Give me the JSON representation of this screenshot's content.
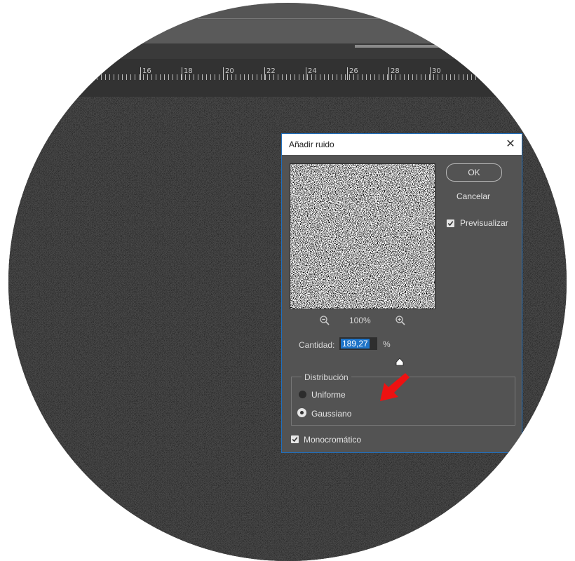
{
  "ruler": {
    "labels": [
      "16",
      "18",
      "20",
      "22",
      "24",
      "26",
      "28",
      "30"
    ]
  },
  "dialog": {
    "title": "Añadir ruido",
    "close_glyph": "✕",
    "ok_label": "OK",
    "cancel_label": "Cancelar",
    "preview_label": "Previsualizar",
    "preview_checked": true,
    "zoom_level": "100%",
    "amount_label": "Cantidad:",
    "amount_value": "189,27",
    "amount_unit": "%",
    "distribution": {
      "legend": "Distribución",
      "options": [
        {
          "label": "Uniforme",
          "selected": false
        },
        {
          "label": "Gaussiano",
          "selected": true
        }
      ]
    },
    "mono_label": "Monocromático",
    "mono_checked": true
  },
  "icons": {
    "zoom_out": "zoom-out-icon",
    "zoom_in": "zoom-in-icon",
    "close": "close-icon",
    "check": "check-icon",
    "slider": "slider-thumb-icon",
    "annotation": "red-arrow-icon"
  },
  "colors": {
    "dialog_bg": "#535353",
    "dialog_border": "#1e6fbf",
    "selection": "#1e74c8",
    "arrow": "#ee1111",
    "lens_ring": "#d4d4d4"
  }
}
